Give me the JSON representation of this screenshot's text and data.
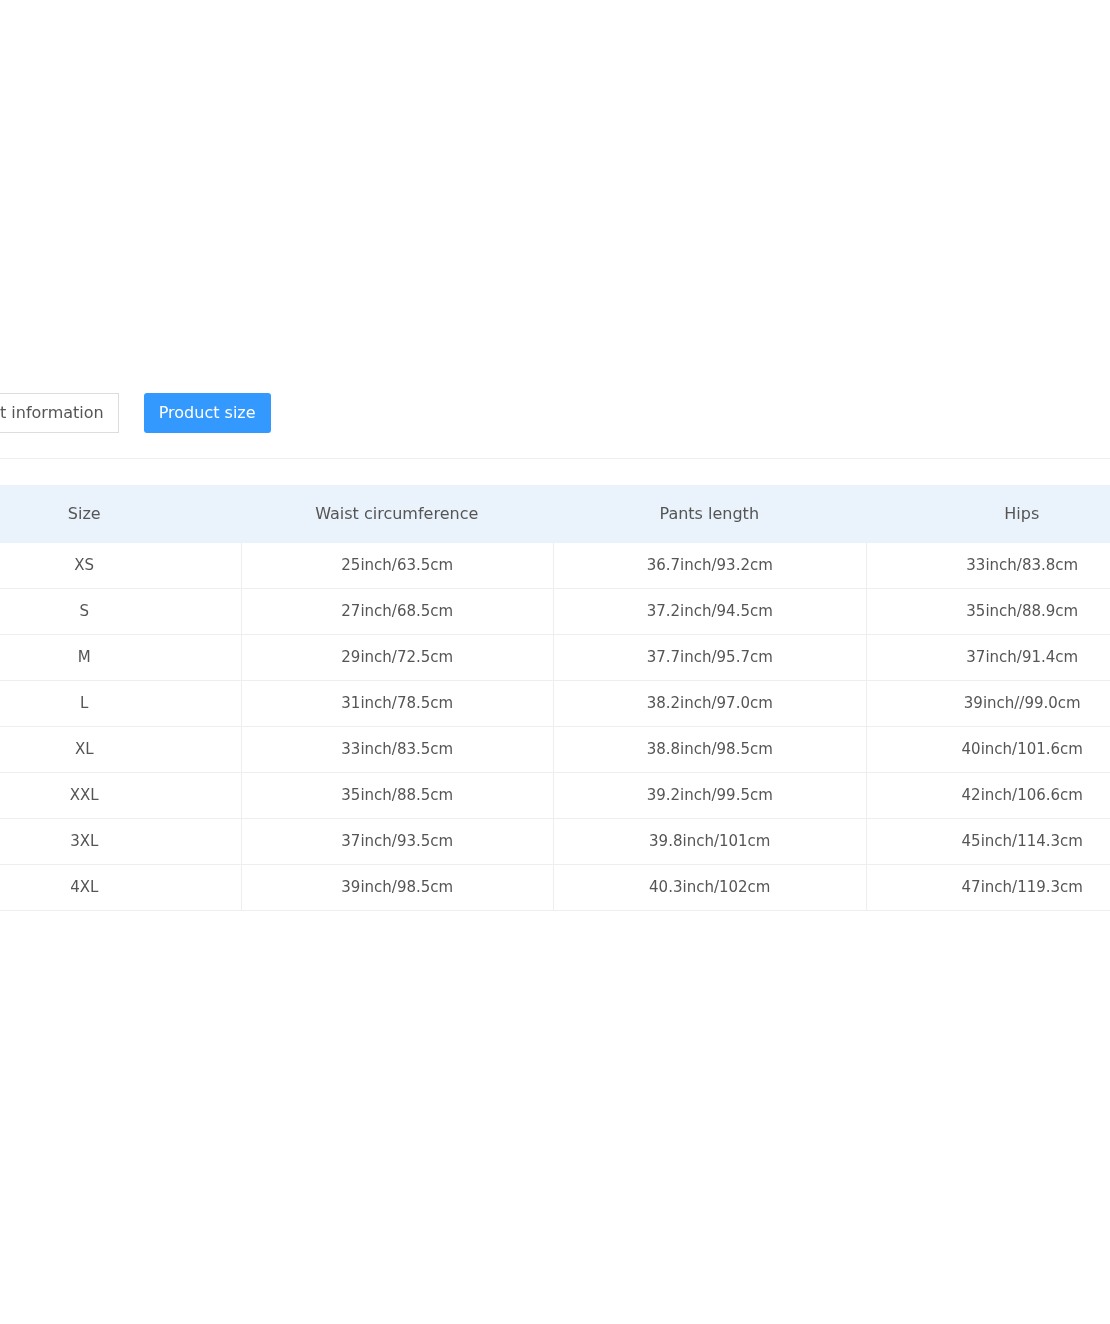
{
  "tabs": [
    {
      "label": "t information",
      "selected": false
    },
    {
      "label": "Product size",
      "selected": true
    }
  ],
  "table": {
    "columns": [
      "Size",
      "Waist circumference",
      "Pants length",
      "Hips"
    ],
    "rows": [
      [
        "XS",
        "25inch/63.5cm",
        "36.7inch/93.2cm",
        "33inch/83.8cm"
      ],
      [
        "S",
        "27inch/68.5cm",
        "37.2inch/94.5cm",
        "35inch/88.9cm"
      ],
      [
        "M",
        "29inch/72.5cm",
        "37.7inch/95.7cm",
        "37inch/91.4cm"
      ],
      [
        "L",
        "31inch/78.5cm",
        "38.2inch/97.0cm",
        "39inch//99.0cm"
      ],
      [
        "XL",
        "33inch/83.5cm",
        "38.8inch/98.5cm",
        "40inch/101.6cm"
      ],
      [
        "XXL",
        "35inch/88.5cm",
        "39.2inch/99.5cm",
        "42inch/106.6cm"
      ],
      [
        "3XL",
        "37inch/93.5cm",
        "39.8inch/101cm",
        "45inch/114.3cm"
      ],
      [
        "4XL",
        "39inch/98.5cm",
        "40.3inch/102cm",
        "47inch/119.3cm"
      ]
    ]
  }
}
